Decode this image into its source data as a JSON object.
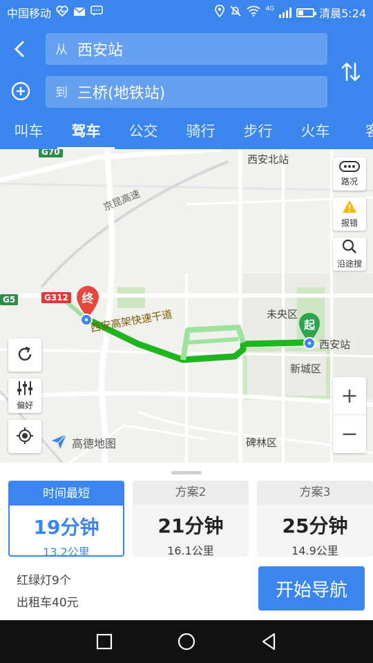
{
  "status_bar": {
    "carrier": "中国移动",
    "network": "4G",
    "battery_level": 0.3,
    "time_text": "清晨5:24"
  },
  "header": {
    "from_prefix": "从",
    "from_value": "西安站",
    "to_prefix": "到",
    "to_value": "三桥(地铁站)",
    "tabs": [
      {
        "label": "叫车"
      },
      {
        "label": "驾车"
      },
      {
        "label": "公交"
      },
      {
        "label": "骑行"
      },
      {
        "label": "步行"
      },
      {
        "label": "火车"
      },
      {
        "label": "客"
      }
    ],
    "active_tab": "驾车"
  },
  "map": {
    "places": {
      "xian_north": "西安北站",
      "weiyang": "未央区",
      "xincheng": "新城区",
      "beilin": "碑林区",
      "station": "西安站"
    },
    "roads": {
      "jingkun": "京昆高速",
      "elevated": "西安高架快速干道"
    },
    "shields": {
      "g70": "G70",
      "g312": "G312",
      "g5": "G5"
    },
    "markers": {
      "end": "终",
      "start": "起"
    },
    "controls": {
      "traffic": "路况",
      "report": "报错",
      "search_along": "沿途搜",
      "preference": "偏好"
    },
    "zoom_in": "+",
    "zoom_out": "−",
    "logo_text": "高德地图",
    "route_color": "#1fb51f"
  },
  "plans": [
    {
      "header": "时间最短",
      "time": "19分钟",
      "distance": "13.2公里"
    },
    {
      "header": "方案2",
      "time": "21分钟",
      "distance": "16.1公里"
    },
    {
      "header": "方案3",
      "time": "25分钟",
      "distance": "14.9公里"
    }
  ],
  "summary": {
    "traffic_lights": "红绿灯9个",
    "taxi_fare": "出租车40元"
  },
  "start_navigation": "开始导航",
  "colors": {
    "primary": "#3a86ee",
    "end_marker": "#e8473f",
    "start_marker": "#2ea44f"
  }
}
